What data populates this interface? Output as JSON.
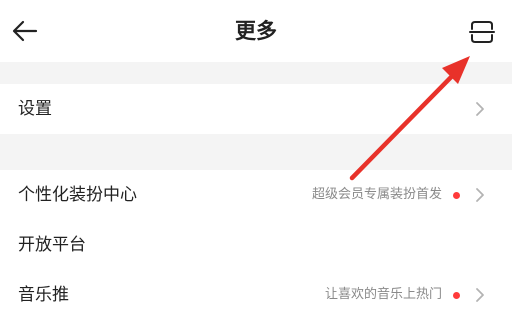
{
  "header": {
    "title": "更多",
    "back_icon": "back-arrow-icon",
    "scan_icon": "scan-icon"
  },
  "settings_row": {
    "label": "设置"
  },
  "rows": [
    {
      "label": "个性化装扮中心",
      "sub": "超级会员专属装扮首发",
      "has_dot": true
    },
    {
      "label": "开放平台",
      "sub": "",
      "has_dot": false
    },
    {
      "label": "音乐推",
      "sub": "让喜欢的音乐上热门",
      "has_dot": true
    }
  ],
  "colors": {
    "accent_red": "#ff3a3a",
    "annotation_arrow": "#e8322a",
    "background": "#f4f4f4"
  }
}
